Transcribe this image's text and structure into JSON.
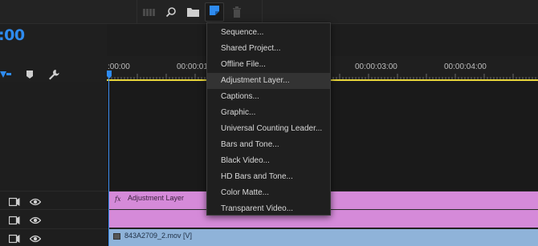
{
  "toolbar": {
    "icons": [
      "bins-icon",
      "search-icon",
      "folder-icon",
      "new-item-icon",
      "trash-icon"
    ],
    "accent": "#2e8bf0"
  },
  "timeline": {
    "timecode": ":00",
    "ruler_labels": [
      ":00:00",
      "00:00:01",
      "00:00:03:00",
      "00:00:04:00"
    ],
    "tracks": [
      {
        "clip_label": "Adjustment Layer",
        "fx": "fx",
        "color": "#d58ad9"
      },
      {
        "clip_label": "",
        "color": "#d58ad9"
      },
      {
        "clip_label": "843A2709_2.mov [V]",
        "color": "#8fb3d9"
      }
    ]
  },
  "menu": {
    "items": [
      "Sequence...",
      "Shared Project...",
      "Offline File...",
      "Adjustment Layer...",
      "Captions...",
      "Graphic...",
      "Universal Counting Leader...",
      "Bars and Tone...",
      "Black Video...",
      "HD Bars and Tone...",
      "Color Matte...",
      "Transparent Video..."
    ],
    "highlighted": "Adjustment Layer..."
  }
}
